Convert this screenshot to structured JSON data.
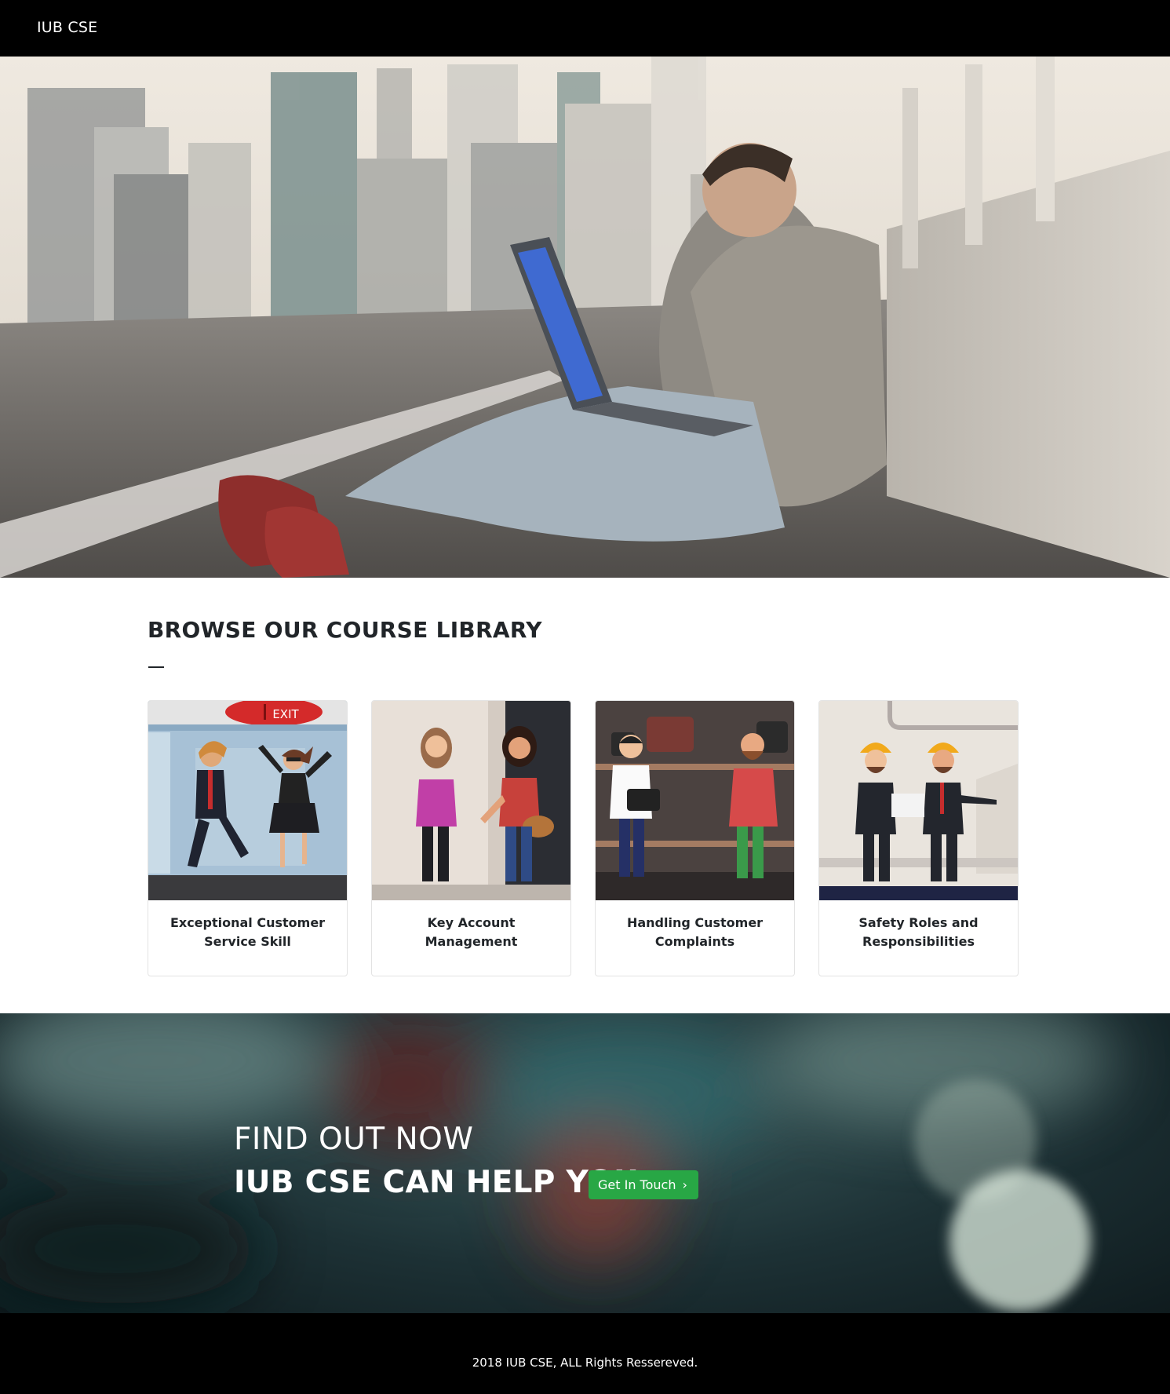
{
  "navbar": {
    "brand": "IUB CSE"
  },
  "courses": {
    "title": "BROWSE OUR COURSE LIBRARY",
    "items": [
      {
        "title": "Exceptional Customer Service Skill",
        "sign": "EXIT"
      },
      {
        "title": "Key Account Management"
      },
      {
        "title": "Handling Customer Complaints"
      },
      {
        "title": "Safety Roles and Responsibilities"
      }
    ]
  },
  "cta": {
    "line1": "FIND OUT NOW",
    "line2": "IUB CSE CAN HELP YOU",
    "button_label": "Get In Touch",
    "button_color": "#28a745"
  },
  "footer": {
    "text": "2018 IUB CSE, ALL Rights Ressereved."
  },
  "icons": {
    "cta_button": "chevron-right-icon"
  }
}
